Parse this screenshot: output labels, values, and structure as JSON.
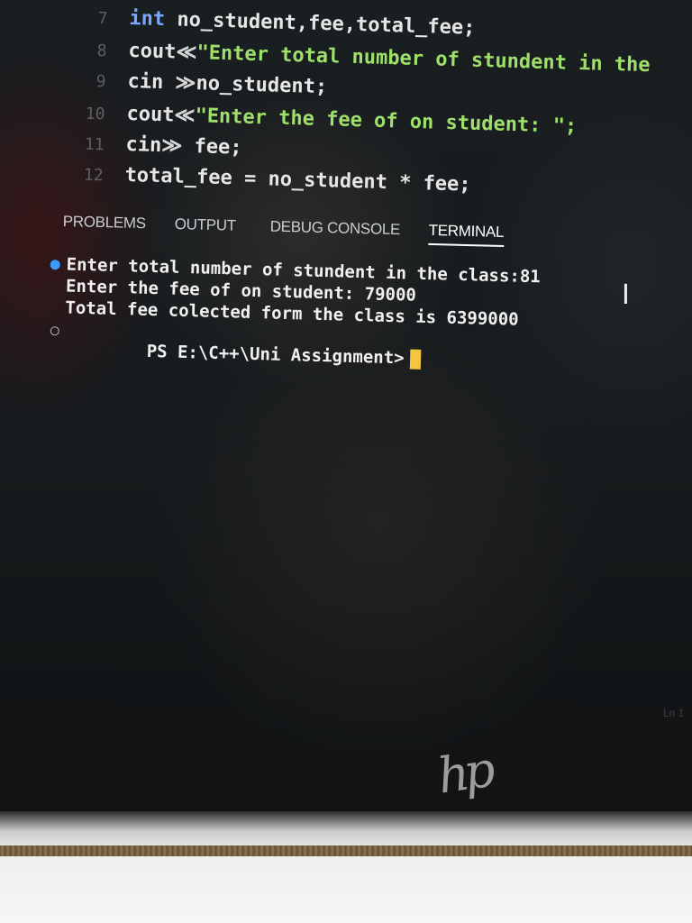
{
  "editor": {
    "lines": [
      {
        "num": "7",
        "parts": [
          {
            "t": "int ",
            "c": "kw"
          },
          {
            "t": "no_student,fee,total_fee;",
            "c": "ident"
          }
        ]
      },
      {
        "num": "8",
        "parts": [
          {
            "t": "cout",
            "c": "ident"
          },
          {
            "t": "≪",
            "c": "op"
          },
          {
            "t": "\"Enter total number of stundent in the",
            "c": "str"
          }
        ]
      },
      {
        "num": "9",
        "parts": [
          {
            "t": "cin ",
            "c": "ident"
          },
          {
            "t": "≫",
            "c": "op"
          },
          {
            "t": "no_student;",
            "c": "ident"
          }
        ]
      },
      {
        "num": "10",
        "parts": [
          {
            "t": "cout",
            "c": "ident"
          },
          {
            "t": "≪",
            "c": "op"
          },
          {
            "t": "\"Enter the fee of on student: \";",
            "c": "str"
          }
        ]
      },
      {
        "num": "11",
        "parts": [
          {
            "t": "cin",
            "c": "ident"
          },
          {
            "t": "≫ ",
            "c": "op"
          },
          {
            "t": "fee;",
            "c": "ident"
          }
        ]
      },
      {
        "num": "12",
        "parts": [
          {
            "t": "total_fee = no_student * fee;",
            "c": "ident"
          }
        ]
      }
    ]
  },
  "panel": {
    "tabs": [
      "PROBLEMS",
      "OUTPUT",
      "DEBUG CONSOLE",
      "TERMINAL"
    ],
    "active_tab": "TERMINAL"
  },
  "terminal": {
    "line1": "Enter total number of stundent in the class:81",
    "line2": "Enter the fee of on student: 79000",
    "line3": "Total fee colected form the class is 6399000",
    "prompt": "PS E:\\C++\\Uni Assignment>"
  },
  "device": {
    "logo": "hp",
    "corner_hint": "Ln 1"
  },
  "colors": {
    "keyword": "#7aa7ff",
    "string": "#9fe06b",
    "cursor": "#f5c542",
    "status_dot": "#3b9cff"
  }
}
